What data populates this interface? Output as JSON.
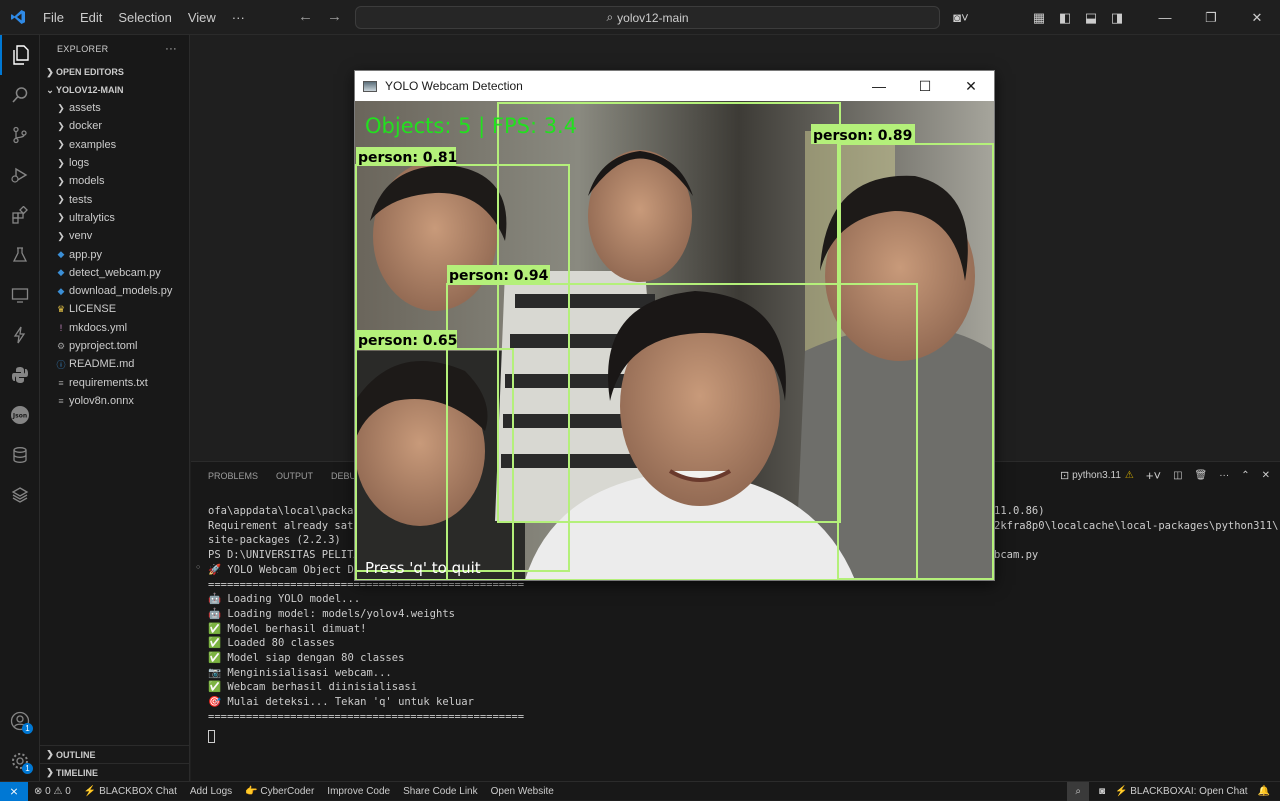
{
  "titlebar": {
    "menu": [
      "File",
      "Edit",
      "Selection",
      "View",
      "···"
    ],
    "search_text": "yolov12-main"
  },
  "explorer": {
    "title": "EXPLORER",
    "open_editors": "OPEN EDITORS",
    "project": "YOLOV12-MAIN",
    "items": [
      {
        "label": "assets",
        "type": "folder"
      },
      {
        "label": "docker",
        "type": "folder"
      },
      {
        "label": "examples",
        "type": "folder"
      },
      {
        "label": "logs",
        "type": "folder"
      },
      {
        "label": "models",
        "type": "folder"
      },
      {
        "label": "tests",
        "type": "folder"
      },
      {
        "label": "ultralytics",
        "type": "folder"
      },
      {
        "label": "venv",
        "type": "folder"
      },
      {
        "label": "app.py",
        "type": "python"
      },
      {
        "label": "detect_webcam.py",
        "type": "python"
      },
      {
        "label": "download_models.py",
        "type": "python"
      },
      {
        "label": "LICENSE",
        "type": "license"
      },
      {
        "label": "mkdocs.yml",
        "type": "yaml"
      },
      {
        "label": "pyproject.toml",
        "type": "toml"
      },
      {
        "label": "README.md",
        "type": "info"
      },
      {
        "label": "requirements.txt",
        "type": "text"
      },
      {
        "label": "yolov8n.onnx",
        "type": "text"
      }
    ],
    "outline": "OUTLINE",
    "timeline": "TIMELINE"
  },
  "panel": {
    "tabs": [
      "PROBLEMS",
      "OUTPUT",
      "DEBUG"
    ],
    "terminal_name": "python3.11",
    "lines_left": [
      "ofa\\appdata\\local\\package",
      "Requirement already satis",
      "site-packages (2.2.3)",
      "PS D:\\UNIVERSITAS PELITA",
      "🚀 YOLO Webcam Object De",
      "==================================================",
      "🤖 Loading YOLO model...",
      "🤖 Loading model: models/yolov4.weights",
      "✅ Model berhasil dimuat!",
      "✅ Loaded 80 classes",
      "✅ Model siap dengan 80 classes",
      "📷 Menginisialisasi webcam...",
      "✅ Webcam berhasil diinisialisasi",
      "🎯 Mulai deteksi... Tekan 'q' untuk keluar",
      "=================================================="
    ],
    "lines_right": [
      "11.0.86)",
      "2kfra8p0\\localcache\\local-packages\\python311\\",
      "",
      "bcam.py"
    ]
  },
  "cv_window": {
    "title": "YOLO Webcam Detection",
    "overlay_status": "Objects: 5 | FPS: 3.4",
    "overlay_hint": "Press 'q' to quit",
    "detections": [
      {
        "label": "person: 0.81",
        "score": 0.81
      },
      {
        "label": "person: 0.89",
        "score": 0.89
      },
      {
        "label": "person: 0.94",
        "score": 0.94
      },
      {
        "label": "person: 0.65",
        "score": 0.65
      },
      {
        "label": "",
        "score": null
      }
    ],
    "box_color": "#b4f07a",
    "status_color": "#22e01f"
  },
  "statusbar": {
    "errors": "0",
    "warnings": "0",
    "items": [
      "BLACKBOX Chat",
      "Add Logs",
      "CyberCoder",
      "Improve Code",
      "Share Code Link",
      "Open Website"
    ],
    "right_item": "BLACKBOXAI: Open Chat"
  },
  "badges": {
    "accounts": "1",
    "settings": "1"
  }
}
